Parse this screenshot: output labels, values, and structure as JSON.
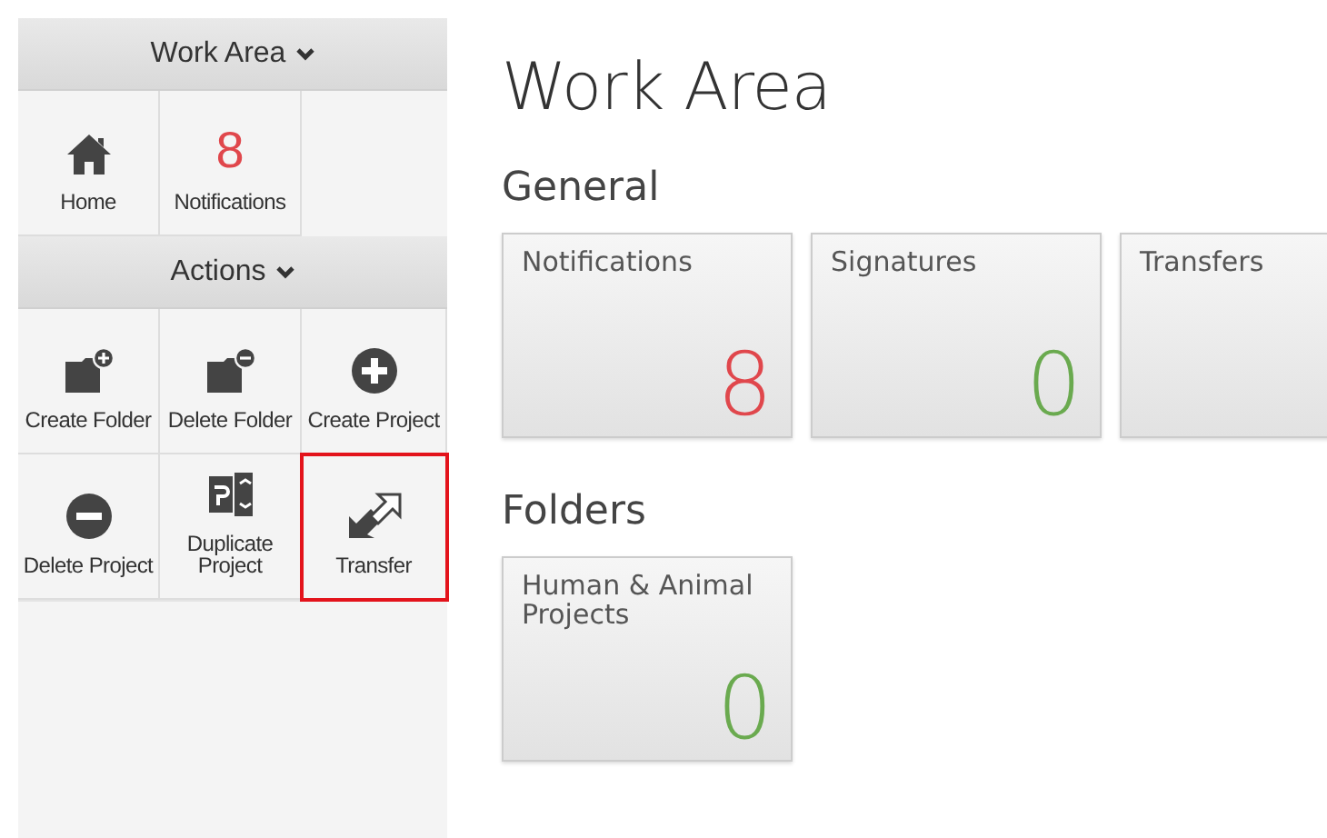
{
  "sidebar": {
    "sections": [
      {
        "title": "Work Area",
        "expanded": true,
        "items": [
          {
            "kind": "icon",
            "label": "Home",
            "highlighted": false
          },
          {
            "kind": "count",
            "count": "8",
            "label": "Notifications",
            "highlighted": false
          }
        ]
      },
      {
        "title": "Actions",
        "expanded": true,
        "items": [
          {
            "kind": "icon",
            "label": "Create Folder",
            "highlighted": false
          },
          {
            "kind": "icon",
            "label": "Delete Folder",
            "highlighted": false
          },
          {
            "kind": "icon",
            "label": "Create Project",
            "highlighted": false
          },
          {
            "kind": "icon",
            "label": "Delete Project",
            "highlighted": false
          },
          {
            "kind": "icon",
            "label": "Duplicate Project",
            "highlighted": false
          },
          {
            "kind": "icon",
            "label": "Transfer",
            "highlighted": true
          }
        ]
      }
    ]
  },
  "main": {
    "title": "Work Area",
    "groups": [
      {
        "heading": "General",
        "tiles": [
          {
            "label": "Notifications",
            "count": "8",
            "color": "#e0474c"
          },
          {
            "label": "Signatures",
            "count": "0",
            "color": "#6aaa4f"
          },
          {
            "label": "Transfers"
          }
        ]
      },
      {
        "heading": "Folders",
        "tiles": [
          {
            "label": "Human & Animal Projects",
            "count": "0",
            "color": "#6aaa4f"
          }
        ]
      }
    ]
  }
}
